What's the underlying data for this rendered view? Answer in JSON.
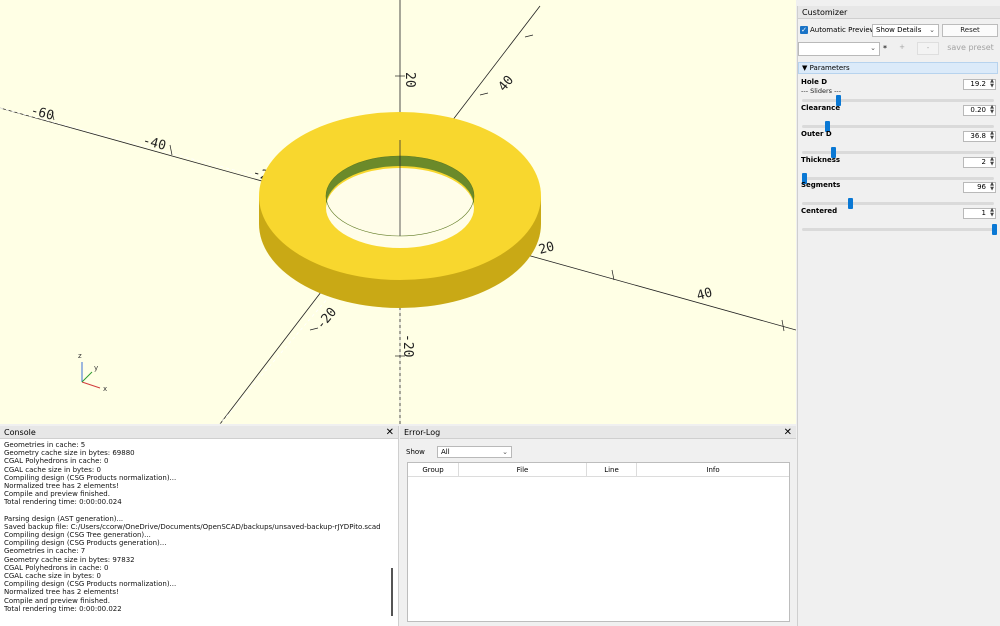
{
  "viewport": {
    "axis_labels": {
      "x_pos_20": "20",
      "x_pos_40": "40",
      "x_neg_20": "-20",
      "x_neg_40": "-40",
      "x_neg_60": "-60",
      "y_pos_20": "20",
      "y_pos_40": "40",
      "y_neg_20": "-20",
      "z_pos_20": "20",
      "z_neg_20": "-20"
    },
    "gizmo": {
      "z": "z",
      "y": "y",
      "x": "x"
    },
    "colors": {
      "background": "#ffffe5",
      "model": "#f8d72e",
      "model_side": "#c9a915",
      "model_inner": "#6b8a2a"
    }
  },
  "console": {
    "title": "Console",
    "lines": [
      "Geometries in cache: 5",
      "Geometry cache size in bytes: 69880",
      "CGAL Polyhedrons in cache: 0",
      "CGAL cache size in bytes: 0",
      "Compiling design (CSG Products normalization)...",
      "Normalized tree has 2 elements!",
      "Compile and preview finished.",
      "Total rendering time: 0:00:00.024",
      "",
      "Parsing design (AST generation)...",
      "Saved backup file: C:/Users/ccorw/OneDrive/Documents/OpenSCAD/backups/unsaved-backup-rJYDPito.scad",
      "Compiling design (CSG Tree generation)...",
      "Compiling design (CSG Products generation)...",
      "Geometries in cache: 7",
      "Geometry cache size in bytes: 97832",
      "CGAL Polyhedrons in cache: 0",
      "CGAL cache size in bytes: 0",
      "Compiling design (CSG Products normalization)...",
      "Normalized tree has 2 elements!",
      "Compile and preview finished.",
      "Total rendering time: 0:00:00.022"
    ]
  },
  "error_log": {
    "title": "Error-Log",
    "show_label": "Show",
    "show_value": "All",
    "columns": [
      "Group",
      "File",
      "Line",
      "Info"
    ]
  },
  "customizer": {
    "title": "Customizer",
    "automatic_preview": "Automatic Preview",
    "details_value": "Show Details",
    "reset": "Reset",
    "preset_star": "*",
    "plus": "+",
    "minus": "-",
    "save_preset": "save preset",
    "group_title": "Parameters",
    "params": [
      {
        "label": "Hole D",
        "sub": "--- Sliders ---",
        "value": "19.2",
        "fraction": 0.18
      },
      {
        "label": "Clearance",
        "sub": "",
        "value": "0.20",
        "fraction": 0.12
      },
      {
        "label": "Outer D",
        "sub": "",
        "value": "36.8",
        "fraction": 0.15
      },
      {
        "label": "Thickness",
        "sub": "",
        "value": "2",
        "fraction": 0.0
      },
      {
        "label": "Segments",
        "sub": "",
        "value": "96",
        "fraction": 0.24
      },
      {
        "label": "Centered",
        "sub": "",
        "value": "1",
        "fraction": 1.0
      }
    ]
  }
}
